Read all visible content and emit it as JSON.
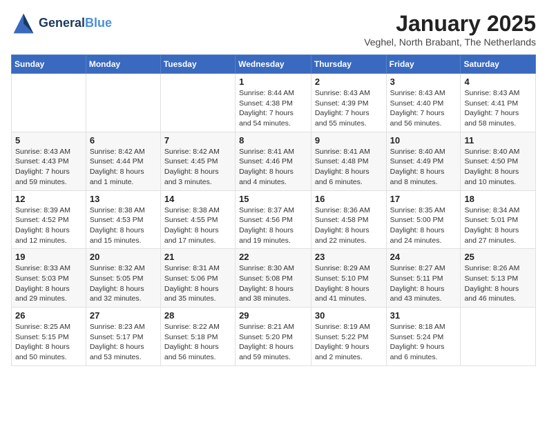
{
  "header": {
    "logo_line1": "General",
    "logo_line2": "Blue",
    "month": "January 2025",
    "location": "Veghel, North Brabant, The Netherlands"
  },
  "weekdays": [
    "Sunday",
    "Monday",
    "Tuesday",
    "Wednesday",
    "Thursday",
    "Friday",
    "Saturday"
  ],
  "weeks": [
    [
      {
        "day": "",
        "info": ""
      },
      {
        "day": "",
        "info": ""
      },
      {
        "day": "",
        "info": ""
      },
      {
        "day": "1",
        "info": "Sunrise: 8:44 AM\nSunset: 4:38 PM\nDaylight: 7 hours\nand 54 minutes."
      },
      {
        "day": "2",
        "info": "Sunrise: 8:43 AM\nSunset: 4:39 PM\nDaylight: 7 hours\nand 55 minutes."
      },
      {
        "day": "3",
        "info": "Sunrise: 8:43 AM\nSunset: 4:40 PM\nDaylight: 7 hours\nand 56 minutes."
      },
      {
        "day": "4",
        "info": "Sunrise: 8:43 AM\nSunset: 4:41 PM\nDaylight: 7 hours\nand 58 minutes."
      }
    ],
    [
      {
        "day": "5",
        "info": "Sunrise: 8:43 AM\nSunset: 4:43 PM\nDaylight: 7 hours\nand 59 minutes."
      },
      {
        "day": "6",
        "info": "Sunrise: 8:42 AM\nSunset: 4:44 PM\nDaylight: 8 hours\nand 1 minute."
      },
      {
        "day": "7",
        "info": "Sunrise: 8:42 AM\nSunset: 4:45 PM\nDaylight: 8 hours\nand 3 minutes."
      },
      {
        "day": "8",
        "info": "Sunrise: 8:41 AM\nSunset: 4:46 PM\nDaylight: 8 hours\nand 4 minutes."
      },
      {
        "day": "9",
        "info": "Sunrise: 8:41 AM\nSunset: 4:48 PM\nDaylight: 8 hours\nand 6 minutes."
      },
      {
        "day": "10",
        "info": "Sunrise: 8:40 AM\nSunset: 4:49 PM\nDaylight: 8 hours\nand 8 minutes."
      },
      {
        "day": "11",
        "info": "Sunrise: 8:40 AM\nSunset: 4:50 PM\nDaylight: 8 hours\nand 10 minutes."
      }
    ],
    [
      {
        "day": "12",
        "info": "Sunrise: 8:39 AM\nSunset: 4:52 PM\nDaylight: 8 hours\nand 12 minutes."
      },
      {
        "day": "13",
        "info": "Sunrise: 8:38 AM\nSunset: 4:53 PM\nDaylight: 8 hours\nand 15 minutes."
      },
      {
        "day": "14",
        "info": "Sunrise: 8:38 AM\nSunset: 4:55 PM\nDaylight: 8 hours\nand 17 minutes."
      },
      {
        "day": "15",
        "info": "Sunrise: 8:37 AM\nSunset: 4:56 PM\nDaylight: 8 hours\nand 19 minutes."
      },
      {
        "day": "16",
        "info": "Sunrise: 8:36 AM\nSunset: 4:58 PM\nDaylight: 8 hours\nand 22 minutes."
      },
      {
        "day": "17",
        "info": "Sunrise: 8:35 AM\nSunset: 5:00 PM\nDaylight: 8 hours\nand 24 minutes."
      },
      {
        "day": "18",
        "info": "Sunrise: 8:34 AM\nSunset: 5:01 PM\nDaylight: 8 hours\nand 27 minutes."
      }
    ],
    [
      {
        "day": "19",
        "info": "Sunrise: 8:33 AM\nSunset: 5:03 PM\nDaylight: 8 hours\nand 29 minutes."
      },
      {
        "day": "20",
        "info": "Sunrise: 8:32 AM\nSunset: 5:05 PM\nDaylight: 8 hours\nand 32 minutes."
      },
      {
        "day": "21",
        "info": "Sunrise: 8:31 AM\nSunset: 5:06 PM\nDaylight: 8 hours\nand 35 minutes."
      },
      {
        "day": "22",
        "info": "Sunrise: 8:30 AM\nSunset: 5:08 PM\nDaylight: 8 hours\nand 38 minutes."
      },
      {
        "day": "23",
        "info": "Sunrise: 8:29 AM\nSunset: 5:10 PM\nDaylight: 8 hours\nand 41 minutes."
      },
      {
        "day": "24",
        "info": "Sunrise: 8:27 AM\nSunset: 5:11 PM\nDaylight: 8 hours\nand 43 minutes."
      },
      {
        "day": "25",
        "info": "Sunrise: 8:26 AM\nSunset: 5:13 PM\nDaylight: 8 hours\nand 46 minutes."
      }
    ],
    [
      {
        "day": "26",
        "info": "Sunrise: 8:25 AM\nSunset: 5:15 PM\nDaylight: 8 hours\nand 50 minutes."
      },
      {
        "day": "27",
        "info": "Sunrise: 8:23 AM\nSunset: 5:17 PM\nDaylight: 8 hours\nand 53 minutes."
      },
      {
        "day": "28",
        "info": "Sunrise: 8:22 AM\nSunset: 5:18 PM\nDaylight: 8 hours\nand 56 minutes."
      },
      {
        "day": "29",
        "info": "Sunrise: 8:21 AM\nSunset: 5:20 PM\nDaylight: 8 hours\nand 59 minutes."
      },
      {
        "day": "30",
        "info": "Sunrise: 8:19 AM\nSunset: 5:22 PM\nDaylight: 9 hours\nand 2 minutes."
      },
      {
        "day": "31",
        "info": "Sunrise: 8:18 AM\nSunset: 5:24 PM\nDaylight: 9 hours\nand 6 minutes."
      },
      {
        "day": "",
        "info": ""
      }
    ]
  ]
}
